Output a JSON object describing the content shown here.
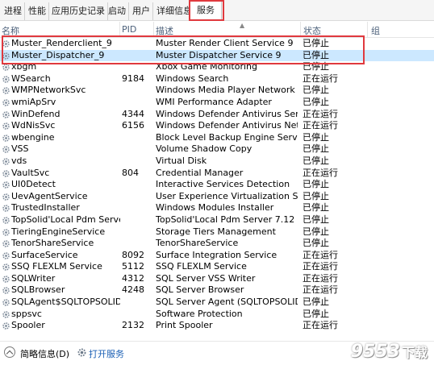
{
  "tabs": [
    {
      "label": "进程",
      "active": false
    },
    {
      "label": "性能",
      "active": false
    },
    {
      "label": "应用历史记录",
      "active": false
    },
    {
      "label": "启动",
      "active": false
    },
    {
      "label": "用户",
      "active": false
    },
    {
      "label": "详细信息",
      "active": false
    },
    {
      "label": "服务",
      "active": true
    }
  ],
  "columns": {
    "name": "名称",
    "pid": "PID",
    "desc": "描述",
    "status": "状态",
    "group": "组"
  },
  "services": [
    {
      "name": "Muster_Renderclient_9",
      "pid": "",
      "desc": "Muster Render Client Service 9",
      "status": "已停止",
      "selected": false
    },
    {
      "name": "Muster_Dispatcher_9",
      "pid": "",
      "desc": "Muster Dispatcher Service 9",
      "status": "已停止",
      "selected": true
    },
    {
      "name": "xbgm",
      "pid": "",
      "desc": "Xbox Game Monitoring",
      "status": "已停止",
      "selected": false
    },
    {
      "name": "WSearch",
      "pid": "9184",
      "desc": "Windows Search",
      "status": "正在运行",
      "selected": false
    },
    {
      "name": "WMPNetworkSvc",
      "pid": "",
      "desc": "Windows Media Player Network Sh...",
      "status": "已停止",
      "selected": false
    },
    {
      "name": "wmiApSrv",
      "pid": "",
      "desc": "WMI Performance Adapter",
      "status": "已停止",
      "selected": false
    },
    {
      "name": "WinDefend",
      "pid": "4344",
      "desc": "Windows Defender Antivirus Service",
      "status": "正在运行",
      "selected": false
    },
    {
      "name": "WdNisSvc",
      "pid": "6156",
      "desc": "Windows Defender Antivirus Netw...",
      "status": "正在运行",
      "selected": false
    },
    {
      "name": "wbengine",
      "pid": "",
      "desc": "Block Level Backup Engine Service",
      "status": "已停止",
      "selected": false
    },
    {
      "name": "VSS",
      "pid": "",
      "desc": "Volume Shadow Copy",
      "status": "已停止",
      "selected": false
    },
    {
      "name": "vds",
      "pid": "",
      "desc": "Virtual Disk",
      "status": "已停止",
      "selected": false
    },
    {
      "name": "VaultSvc",
      "pid": "804",
      "desc": "Credential Manager",
      "status": "正在运行",
      "selected": false
    },
    {
      "name": "UI0Detect",
      "pid": "",
      "desc": "Interactive Services Detection",
      "status": "已停止",
      "selected": false
    },
    {
      "name": "UevAgentService",
      "pid": "",
      "desc": "User Experience Virtualization Servi...",
      "status": "已停止",
      "selected": false
    },
    {
      "name": "TrustedInstaller",
      "pid": "",
      "desc": "Windows Modules Installer",
      "status": "已停止",
      "selected": false
    },
    {
      "name": "TopSolid'Local Pdm Serve...",
      "pid": "",
      "desc": "TopSolid'Local Pdm Server 7.12",
      "status": "已停止",
      "selected": false
    },
    {
      "name": "TieringEngineService",
      "pid": "",
      "desc": "Storage Tiers Management",
      "status": "已停止",
      "selected": false
    },
    {
      "name": "TenorShareService",
      "pid": "",
      "desc": "TenorShareService",
      "status": "已停止",
      "selected": false
    },
    {
      "name": "SurfaceService",
      "pid": "8092",
      "desc": "Surface Integration Service",
      "status": "正在运行",
      "selected": false
    },
    {
      "name": "SSQ FLEXLM Service",
      "pid": "5112",
      "desc": "SSQ FLEXLM Service",
      "status": "正在运行",
      "selected": false
    },
    {
      "name": "SQLWriter",
      "pid": "4312",
      "desc": "SQL Server VSS Writer",
      "status": "正在运行",
      "selected": false
    },
    {
      "name": "SQLBrowser",
      "pid": "4248",
      "desc": "SQL Server Browser",
      "status": "正在运行",
      "selected": false
    },
    {
      "name": "SQLAgent$SQLTOPSOLID",
      "pid": "",
      "desc": "SQL Server Agent (SQLTOPSOLID)",
      "status": "已停止",
      "selected": false
    },
    {
      "name": "sppsvc",
      "pid": "",
      "desc": "Software Protection",
      "status": "已停止",
      "selected": false
    },
    {
      "name": "Spooler",
      "pid": "2132",
      "desc": "Print Spooler",
      "status": "正在运行",
      "selected": false
    }
  ],
  "footer": {
    "brief_label": "简略信息(D)",
    "open_services_label": "打开服务"
  },
  "watermark": {
    "text": "9553",
    "suffix": "下载"
  },
  "colors": {
    "highlight": "#e0393e",
    "selected_row": "#cce8ff",
    "header_text": "#4c607a",
    "link": "#1a5fb4"
  },
  "icons": {
    "service": "gear-icon",
    "collapse": "chevron-up-icon",
    "open_services": "gear-icon"
  }
}
